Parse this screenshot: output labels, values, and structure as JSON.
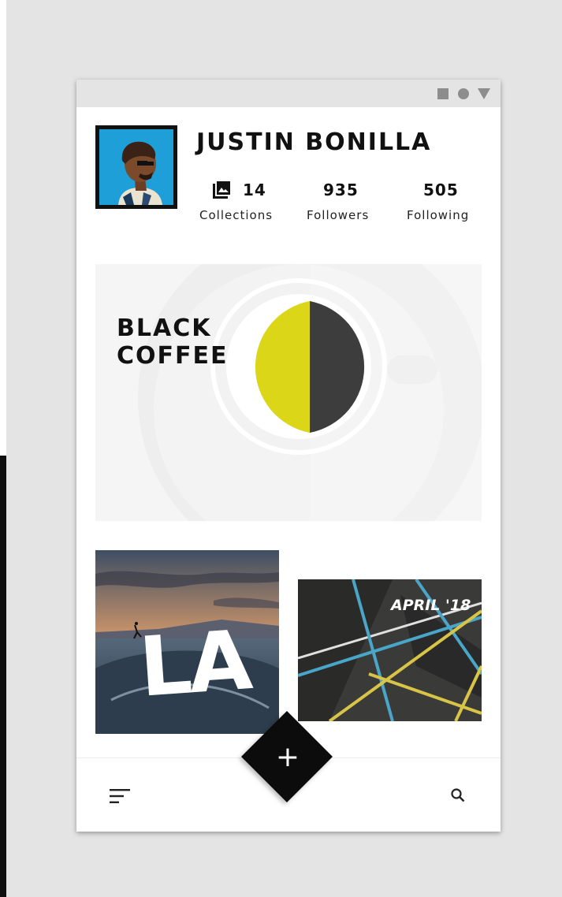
{
  "profile": {
    "name": "JUSTIN BONILLA",
    "stats": [
      {
        "value": "14",
        "label": "Collections"
      },
      {
        "value": "935",
        "label": "Followers"
      },
      {
        "value": "505",
        "label": "Following"
      }
    ]
  },
  "collections": [
    {
      "title_line1": "BLACK",
      "title_line2": "COFFEE"
    },
    {
      "title": "LA"
    },
    {
      "title": "APRIL '18"
    }
  ],
  "bottom_nav": {
    "fab_label": "+",
    "menu_icon": "menu-icon",
    "search_icon": "search-icon"
  },
  "colors": {
    "accent_yellow": "#dcd618",
    "ink": "#111111"
  }
}
